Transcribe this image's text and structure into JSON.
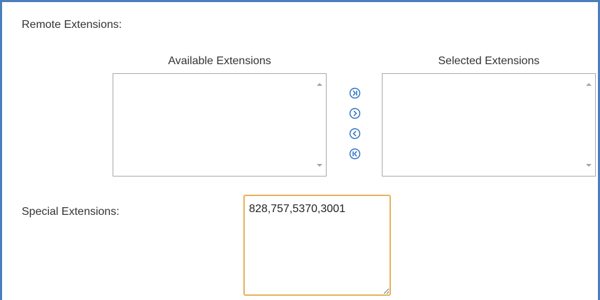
{
  "remote_extensions": {
    "label": "Remote Extensions:",
    "available_header": "Available Extensions",
    "selected_header": "Selected Extensions",
    "available_items": [],
    "selected_items": [],
    "move_buttons": [
      "move-all-right-icon",
      "move-right-icon",
      "move-left-icon",
      "move-all-left-icon"
    ]
  },
  "special_extensions": {
    "label": "Special Extensions:",
    "value": "828,757,5370,3001"
  },
  "colors": {
    "frame_border": "#4a7ebb",
    "input_focus_border": "#e8b15a",
    "icon_blue": "#2a6fc4"
  }
}
